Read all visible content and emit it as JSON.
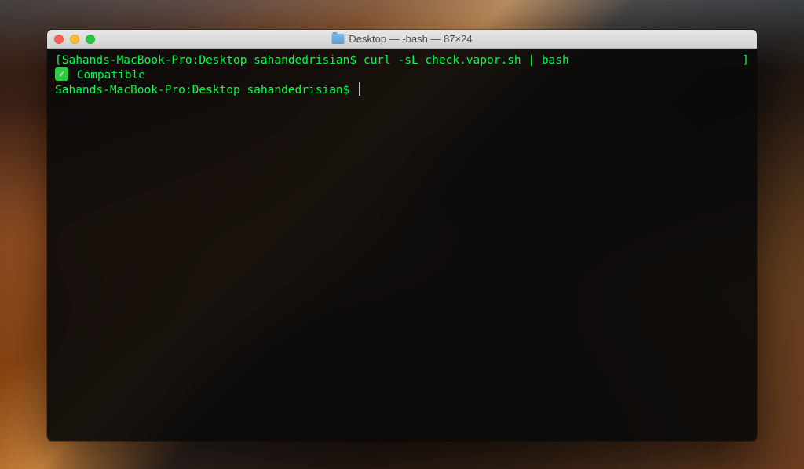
{
  "window": {
    "title": "Desktop — -bash — 87×24",
    "folder_name": "Desktop"
  },
  "terminal": {
    "lines": [
      {
        "left_bracket": "[",
        "prompt": "Sahands-MacBook-Pro:Desktop sahandedrisian$ ",
        "command": "curl -sL check.vapor.sh | bash",
        "right_bracket": "]"
      }
    ],
    "output": {
      "check_icon": "check",
      "text": " Compatible"
    },
    "prompt2": "Sahands-MacBook-Pro:Desktop sahandedrisian$ "
  },
  "colors": {
    "terminal_bg": "rgba(10,10,10,0.92)",
    "text_green": "#00ff41",
    "titlebar_text": "#4a4a4a"
  }
}
